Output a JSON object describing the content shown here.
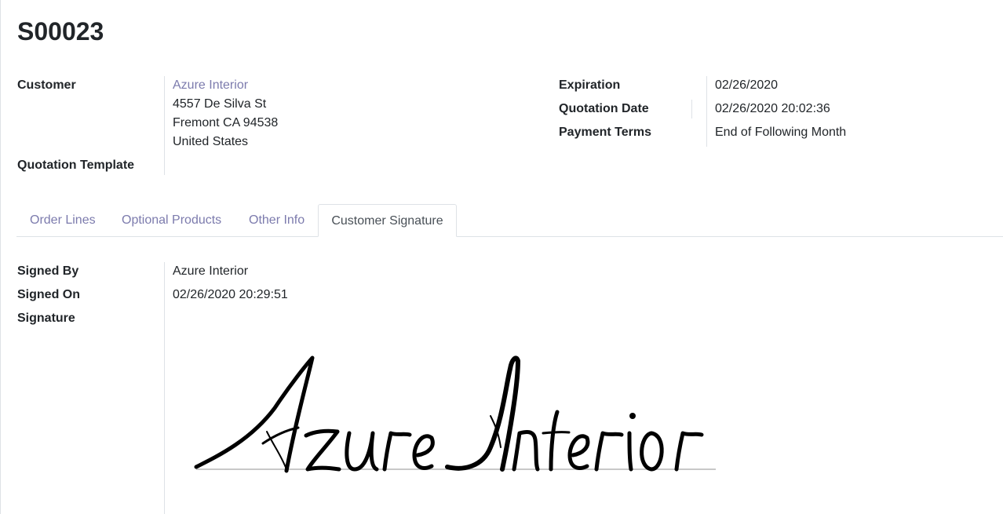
{
  "record": {
    "title": "S00023"
  },
  "customer": {
    "label": "Customer",
    "name": "Azure Interior",
    "street": "4557 De Silva St",
    "city_line": "Fremont CA 94538",
    "country": "United States"
  },
  "quotation_template": {
    "label": "Quotation Template",
    "value": ""
  },
  "expiration": {
    "label": "Expiration",
    "value": "02/26/2020"
  },
  "quotation_date": {
    "label": "Quotation Date",
    "value": "02/26/2020 20:02:36"
  },
  "payment_terms": {
    "label": "Payment Terms",
    "value": "End of Following Month"
  },
  "tabs": [
    {
      "label": "Order Lines",
      "active": false
    },
    {
      "label": "Optional Products",
      "active": false
    },
    {
      "label": "Other Info",
      "active": false
    },
    {
      "label": "Customer Signature",
      "active": true
    }
  ],
  "signature_section": {
    "signed_by_label": "Signed By",
    "signed_by_value": "Azure Interior",
    "signed_on_label": "Signed On",
    "signed_on_value": "02/26/2020 20:29:51",
    "signature_label": "Signature",
    "signature_text": "Azure Interior"
  },
  "colors": {
    "link": "#7c7bad",
    "text": "#212529",
    "border": "#dee2e6"
  }
}
